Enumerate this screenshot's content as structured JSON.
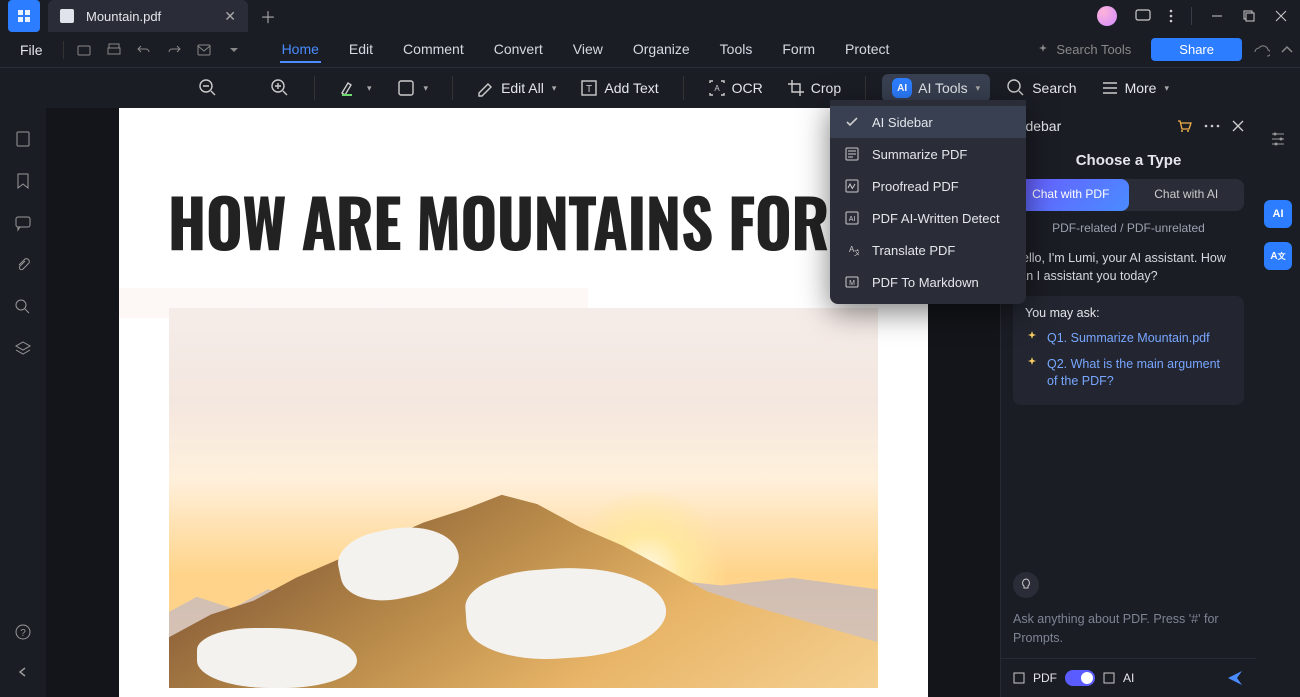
{
  "title_tab": "Mountain.pdf",
  "file_menu": "File",
  "menu": [
    "Home",
    "Edit",
    "Comment",
    "Convert",
    "View",
    "Organize",
    "Tools",
    "Form",
    "Protect"
  ],
  "search_tools_ph": "Search Tools",
  "share": "Share",
  "toolbar": {
    "edit_all": "Edit All",
    "add_text": "Add Text",
    "ocr": "OCR",
    "crop": "Crop",
    "ai_tools": "AI Tools",
    "search": "Search",
    "more": "More"
  },
  "doc": {
    "heading": "HOW ARE MOUNTAINS FORMED"
  },
  "ai_menu": [
    "AI Sidebar",
    "Summarize PDF",
    "Proofread PDF",
    "PDF AI-Written Detect",
    "Translate PDF",
    "PDF To Markdown"
  ],
  "sidebar": {
    "title": "Sidebar",
    "choose_type": "Choose a Type",
    "tab_pdf": "Chat with PDF",
    "tab_ai": "Chat with AI",
    "related": "PDF-related / PDF-unrelated",
    "greeting": "Hello, I'm Lumi, your AI assistant. How can I assistant you today?",
    "you_may_ask": "You may ask:",
    "q1": "Q1. Summarize Mountain.pdf",
    "q2": "Q2. What is the main argument of the PDF?",
    "prompt_ph": "Ask anything about PDF. Press '#' for Prompts.",
    "foot_pdf": "PDF",
    "foot_ai": "AI"
  }
}
